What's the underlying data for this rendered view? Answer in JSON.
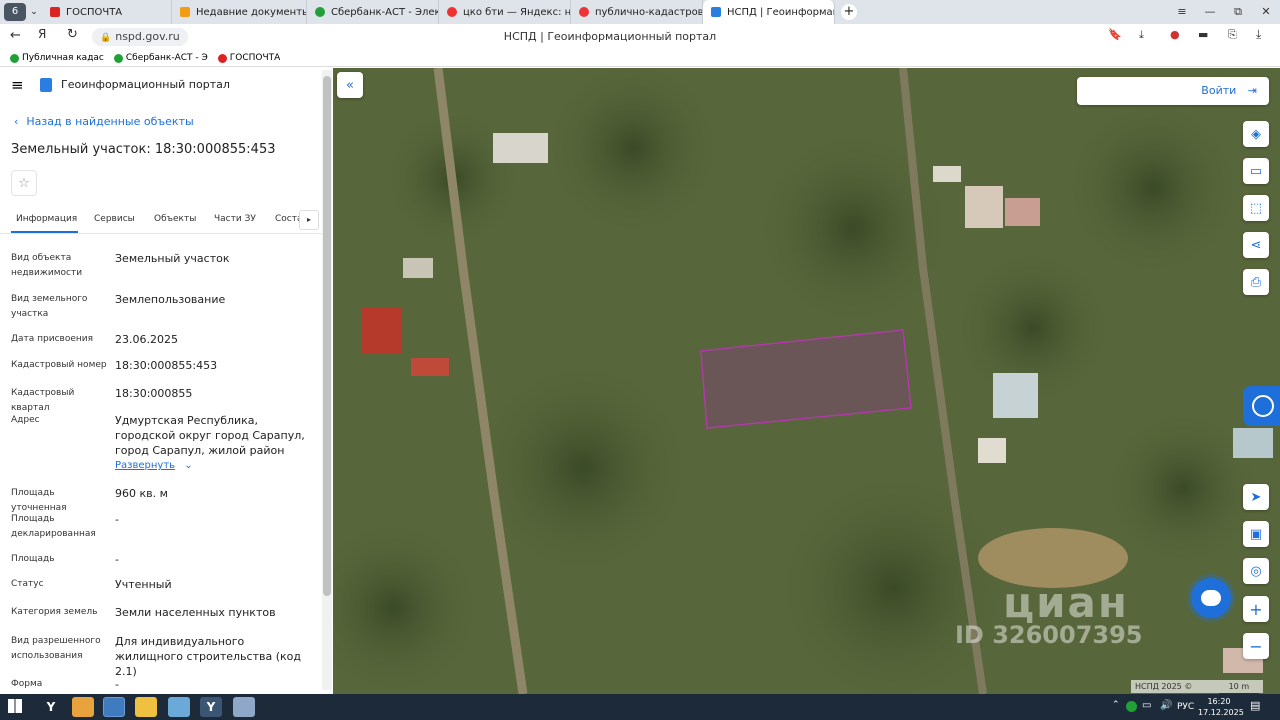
{
  "browser": {
    "tab_count": "6",
    "tabs": [
      {
        "label": "ГОСПОЧТА"
      },
      {
        "label": "Недавние документы"
      },
      {
        "label": "Сбербанк-АСТ - Электрон"
      },
      {
        "label": "цко бти — Яндекс: нашло"
      },
      {
        "label": "публично-кадастровая к"
      },
      {
        "label": "НСПД | Геоинформаци"
      }
    ],
    "url": "nspd.gov.ru",
    "page_title": "НСПД | Геоинформационный портал",
    "bookmarks": [
      "Публичная кадас",
      "Сбербанк-АСТ - Э",
      "ГОСПОЧТА"
    ]
  },
  "portal": {
    "title": "Геоинформационный портал",
    "back_label": "Назад в найденные объекты",
    "object_title": "Земельный участок: 18:30:000855:453",
    "tabs": [
      "Информация",
      "Сервисы",
      "Объекты",
      "Части ЗУ",
      "Соста"
    ],
    "details": [
      {
        "label": "Вид объекта недвижимости",
        "value": "Земельный участок"
      },
      {
        "label": "Вид земельного участка",
        "value": "Землепользование"
      },
      {
        "label": "Дата присвоения",
        "value": "23.06.2025"
      },
      {
        "label": "Кадастровый номер",
        "value": "18:30:000855:453"
      },
      {
        "label": "Кадастровый квартал",
        "value": "18:30:000855"
      },
      {
        "label": "Адрес",
        "value": "Удмуртская Республика, городской округ город Сарапул, город Сарапул, жилой район Новосельский, улица"
      },
      {
        "label": "Площадь уточненная",
        "value": "960 кв. м"
      },
      {
        "label": "Площадь декларированная",
        "value": "-"
      },
      {
        "label": "Площадь",
        "value": "-"
      },
      {
        "label": "Статус",
        "value": "Учтенный"
      },
      {
        "label": "Категория земель",
        "value": "Земли населенных пунктов"
      },
      {
        "label": "Вид разрешенного использования",
        "value": "Для индивидуального жилищного строительства (код 2.1)"
      },
      {
        "label": "Форма собственности",
        "value": "-"
      }
    ],
    "expand_label": "Развернуть"
  },
  "map": {
    "login_label": "Войти",
    "watermark_brand": "циан",
    "watermark_id": "ID 326007395",
    "copyright": "НСПД 2025 ©",
    "scale_label": "10 m",
    "parcel_color": "#b03aa8"
  },
  "taskbar": {
    "lang": "РУС",
    "time": "16:20",
    "date": "17.12.2025"
  }
}
